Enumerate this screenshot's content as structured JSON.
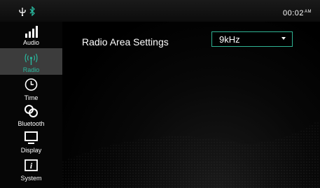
{
  "status": {
    "clock_time": "00:02",
    "clock_ampm": "AM",
    "icons": [
      "usb-icon",
      "bluetooth-icon"
    ],
    "bluetooth_color": "#29b89e"
  },
  "sidebar": {
    "items": [
      {
        "label": "Audio",
        "icon": "audio-bars-icon",
        "active": false
      },
      {
        "label": "Radio",
        "icon": "radio-antenna-icon",
        "active": true
      },
      {
        "label": "Time",
        "icon": "clock-icon",
        "active": false
      },
      {
        "label": "Bluetooth",
        "icon": "bluetooth-link-icon",
        "active": false
      },
      {
        "label": "Display",
        "icon": "monitor-icon",
        "active": false
      },
      {
        "label": "System",
        "icon": "info-icon",
        "active": false
      }
    ],
    "active_color": "#29b89e"
  },
  "main": {
    "setting_label": "Radio Area Settings",
    "select": {
      "value": "9kHz",
      "border_color": "#2fb393"
    }
  }
}
